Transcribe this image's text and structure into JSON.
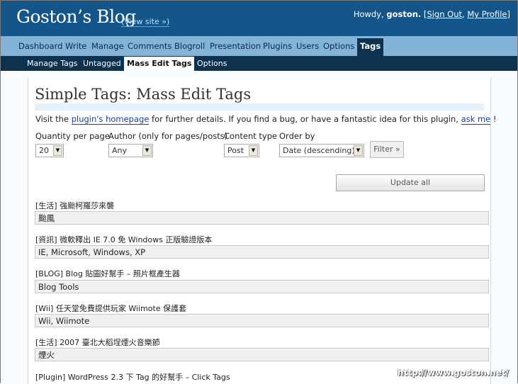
{
  "header": {
    "site_title": "Goston’s Blog",
    "view_site": "(View site »)",
    "howdy": "Howdy, ",
    "username": "goston.",
    "sign_out": "Sign Out",
    "my_profile": "My Profile",
    "open_bracket": " [",
    "separator": ", ",
    "close_bracket": "]"
  },
  "main_nav": [
    "Dashboard",
    "Write",
    "Manage",
    "Comments",
    "Blogroll",
    "Presentation",
    "Plugins",
    "Users",
    "Options",
    "Tags"
  ],
  "sub_nav": [
    "Manage Tags",
    "Untagged",
    "Mass Edit Tags",
    "Options"
  ],
  "page": {
    "title": "Simple Tags: Mass Edit Tags",
    "intro_prefix": "Visit the ",
    "intro_link": "plugin's homepage",
    "intro_middle": " for further details. If you find a bug, or have a fantastic idea for this plugin, ",
    "intro_link2": "ask me",
    "intro_suffix": " !"
  },
  "filters": {
    "quantity_label": "Quantity per page",
    "quantity_value": "20",
    "author_label": "Author (only for pages/posts)",
    "author_value": "Any",
    "content_type_label": "Content type",
    "content_type_value": "Post",
    "order_label": "Order by",
    "order_value": "Date (descending)",
    "filter_button": "Filter »"
  },
  "update_all_label": "Update all",
  "posts": [
    {
      "title": "[生活] 強颱柯羅莎來襲",
      "tags": "颱風"
    },
    {
      "title": "[資訊] 微軟釋出 IE 7.0 免 Windows 正版驗證版本",
      "tags": "IE, Microsoft, Windows, XP"
    },
    {
      "title": "[BLOG] Blog 貼圖好幫手 – 照片框產生器",
      "tags": "Blog Tools"
    },
    {
      "title": "[Wii] 任天堂免費提供玩家 Wiimote 保護套",
      "tags": "Wii, Wiimote"
    },
    {
      "title": "[生活] 2007 臺北大稻埕煙火音樂節",
      "tags": "煙火"
    },
    {
      "title": "[Plugin] WordPress 2.3 下 Tag 的好幫手 – Click Tags",
      "tags": ""
    }
  ],
  "watermark": "http://www.goston.net/",
  "colors": {
    "header_bg": "#14568a",
    "nav_bg": "#83b4d8",
    "subnav_bg": "#0d324f"
  }
}
